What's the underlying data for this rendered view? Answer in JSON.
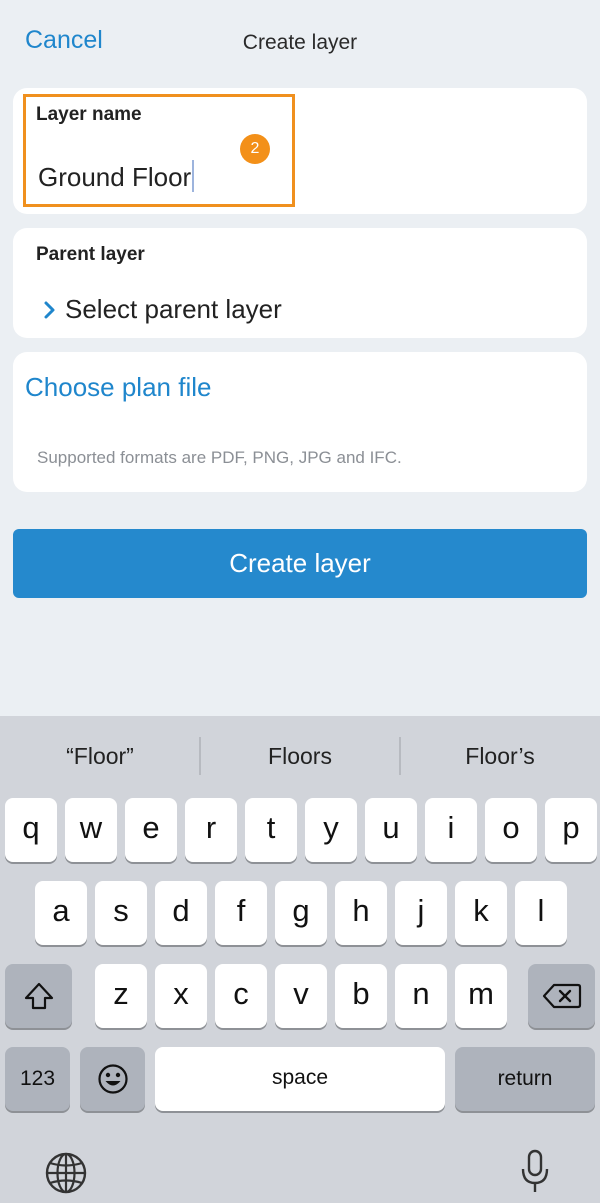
{
  "nav": {
    "cancel": "Cancel",
    "title": "Create layer"
  },
  "layer_name": {
    "label": "Layer name",
    "value": "Ground Floor",
    "badge": "2"
  },
  "parent_layer": {
    "label": "Parent layer",
    "select_text": "Select parent layer"
  },
  "plan_file": {
    "link": "Choose plan file",
    "hint": "Supported formats are PDF, PNG, JPG and IFC."
  },
  "create_button": "Create layer",
  "colors": {
    "accent": "#1f86cc",
    "button": "#2589cd",
    "highlight": "#f0901e",
    "badge": "#f39019"
  },
  "keyboard": {
    "suggestions": [
      "“Floor”",
      "Floors",
      "Floor’s"
    ],
    "row1": [
      "q",
      "w",
      "e",
      "r",
      "t",
      "y",
      "u",
      "i",
      "o",
      "p"
    ],
    "row2": [
      "a",
      "s",
      "d",
      "f",
      "g",
      "h",
      "j",
      "k",
      "l"
    ],
    "row3": [
      "z",
      "x",
      "c",
      "v",
      "b",
      "n",
      "m"
    ],
    "numbers_key": "123",
    "space_key": "space",
    "return_key": "return",
    "icons": [
      "shift-icon",
      "backspace-icon",
      "emoji-icon",
      "globe-icon",
      "microphone-icon"
    ]
  }
}
